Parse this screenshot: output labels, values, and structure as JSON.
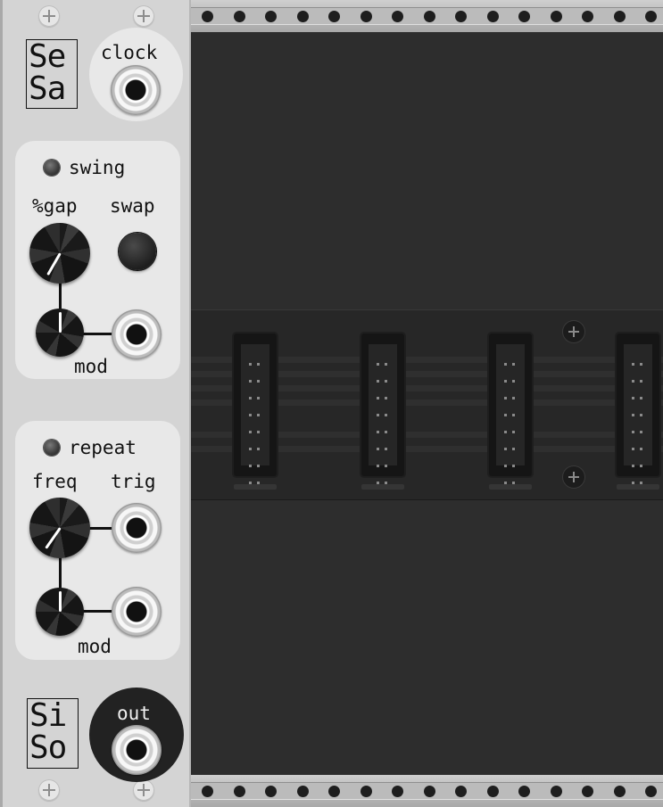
{
  "module": {
    "top_logo": [
      "Se",
      "Sa"
    ],
    "bottom_logo": [
      "Si",
      "So"
    ],
    "clock_label": "clock",
    "swing": {
      "title": "swing",
      "knob_label": "%gap",
      "button_label": "swap",
      "mod_label": "mod"
    },
    "repeat": {
      "title": "repeat",
      "knob_label": "freq",
      "jack_label": "trig",
      "mod_label": "mod"
    },
    "out_label": "out"
  },
  "colors": {
    "panel": "#d4d4d4",
    "section_background": "#e8e8e8",
    "output_bubble": "#222222",
    "rack_background": "#2d2d2d",
    "rail": "#bdbdbd"
  },
  "icons": {
    "screw": "screw-icon",
    "jack": "jack-socket-icon",
    "led": "led-indicator-icon"
  }
}
